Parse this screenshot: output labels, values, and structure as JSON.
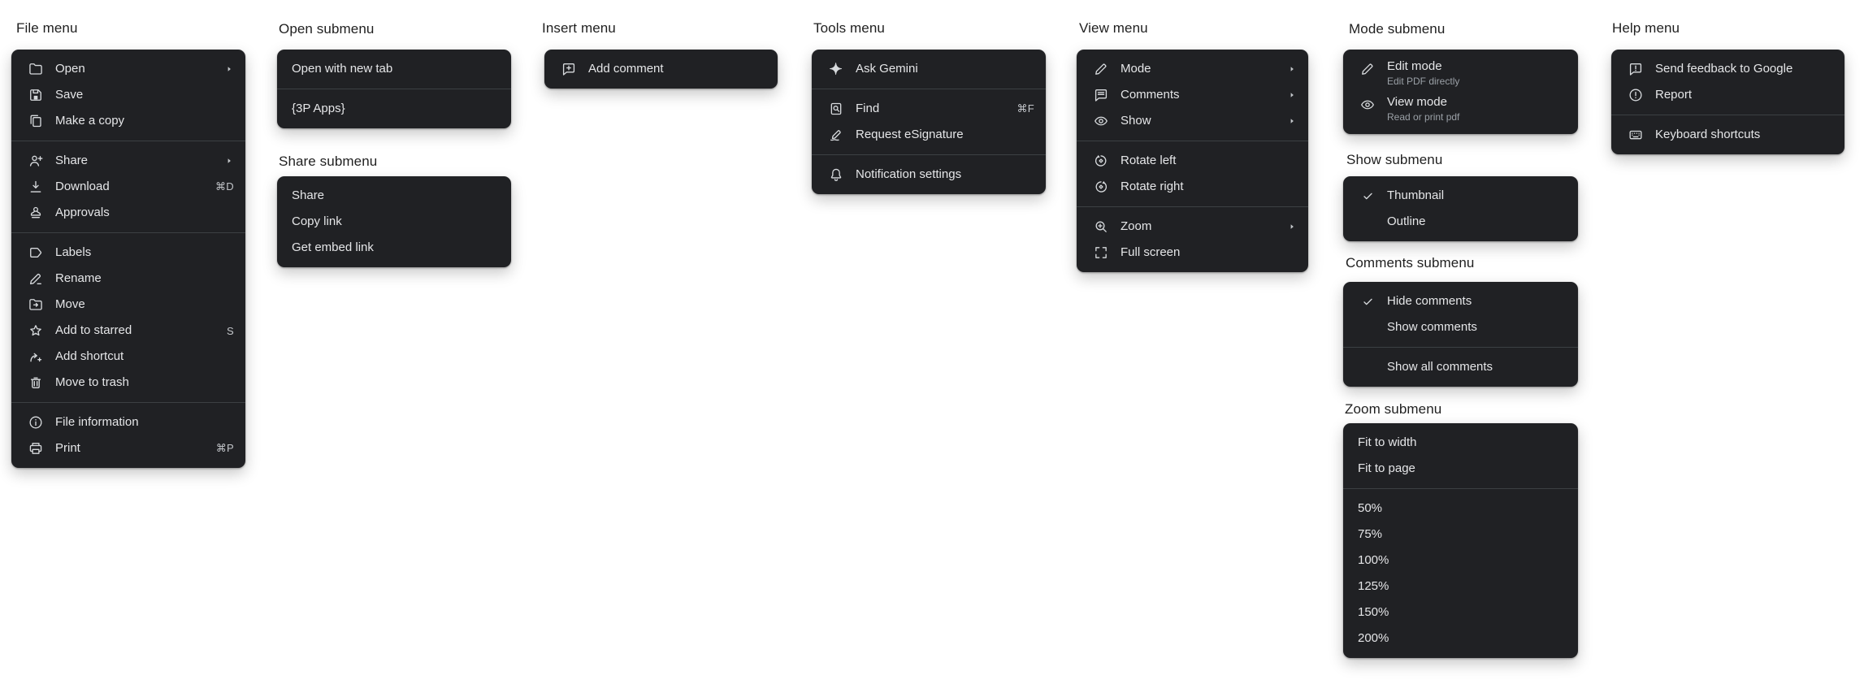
{
  "colors": {
    "page_background": "#ffffff",
    "panel_background": "#202124",
    "panel_text": "#e5e6e8",
    "sublabel_text": "#9aa0a6",
    "shortcut_text": "#c3c6ca",
    "heading_text": "#1f1f1f",
    "divider": "#3c4043",
    "icon": "#d7dadd"
  },
  "menus": {
    "file": {
      "heading": "File menu",
      "items": [
        {
          "label": "Open",
          "icon": "folder-icon",
          "submenu": true
        },
        {
          "label": "Save",
          "icon": "save-icon"
        },
        {
          "label": "Make a copy",
          "icon": "copy-icon"
        },
        {
          "divider": true
        },
        {
          "label": "Share",
          "icon": "person-add-icon",
          "submenu": true
        },
        {
          "label": "Download",
          "icon": "download-icon",
          "shortcut": "⌘D"
        },
        {
          "label": "Approvals",
          "icon": "approvals-stamp-icon"
        },
        {
          "divider": true
        },
        {
          "label": "Labels",
          "icon": "label-icon"
        },
        {
          "label": "Rename",
          "icon": "rename-pencil-icon"
        },
        {
          "label": "Move",
          "icon": "folder-move-icon"
        },
        {
          "label": "Add to starred",
          "icon": "star-icon",
          "shortcut": "S"
        },
        {
          "label": "Add shortcut",
          "icon": "add-shortcut-icon"
        },
        {
          "label": "Move to trash",
          "icon": "trash-icon"
        },
        {
          "divider": true
        },
        {
          "label": "File information",
          "icon": "info-icon"
        },
        {
          "label": "Print",
          "icon": "print-icon",
          "shortcut": "⌘P"
        }
      ]
    },
    "open": {
      "heading": "Open submenu",
      "items": [
        {
          "label": "Open with new tab"
        },
        {
          "divider": true
        },
        {
          "label": "{3P Apps}"
        }
      ]
    },
    "share": {
      "heading": "Share submenu",
      "items": [
        {
          "label": "Share"
        },
        {
          "label": "Copy link"
        },
        {
          "label": "Get embed link"
        }
      ]
    },
    "insert": {
      "heading": "Insert menu",
      "items": [
        {
          "label": "Add comment",
          "icon": "comment-add-icon"
        }
      ]
    },
    "tools": {
      "heading": "Tools menu",
      "items": [
        {
          "label": "Ask Gemini",
          "icon": "spark-icon"
        },
        {
          "divider": true
        },
        {
          "label": "Find",
          "icon": "find-document-icon",
          "shortcut": "⌘F"
        },
        {
          "label": "Request eSignature",
          "icon": "esignature-icon"
        },
        {
          "divider": true
        },
        {
          "label": "Notification settings",
          "icon": "bell-icon"
        }
      ]
    },
    "view": {
      "heading": "View menu",
      "items": [
        {
          "label": "Mode",
          "icon": "pencil-icon",
          "submenu": true
        },
        {
          "label": "Comments",
          "icon": "comment-icon",
          "submenu": true
        },
        {
          "label": "Show",
          "icon": "eye-icon",
          "submenu": true
        },
        {
          "divider": true
        },
        {
          "label": "Rotate left",
          "icon": "rotate-left-icon"
        },
        {
          "label": "Rotate right",
          "icon": "rotate-right-icon"
        },
        {
          "divider": true
        },
        {
          "label": "Zoom",
          "icon": "zoom-in-icon",
          "submenu": true
        },
        {
          "label": "Full screen",
          "icon": "fullscreen-icon"
        }
      ]
    },
    "mode": {
      "heading": "Mode submenu",
      "items": [
        {
          "label": "Edit mode",
          "sublabel": "Edit PDF directly",
          "icon": "pencil-icon"
        },
        {
          "label": "View mode",
          "sublabel": "Read or print pdf",
          "icon": "eye-icon"
        }
      ]
    },
    "show": {
      "heading": "Show submenu",
      "items": [
        {
          "label": "Thumbnail",
          "checked": true
        },
        {
          "label": "Outline"
        }
      ]
    },
    "comments": {
      "heading": "Comments submenu",
      "items": [
        {
          "label": "Hide comments",
          "checked": true
        },
        {
          "label": "Show comments"
        },
        {
          "divider": true
        },
        {
          "label": "Show all comments"
        }
      ]
    },
    "zoom": {
      "heading": "Zoom submenu",
      "items": [
        {
          "label": "Fit to width"
        },
        {
          "label": "Fit to page"
        },
        {
          "divider": true
        },
        {
          "label": "50%"
        },
        {
          "label": "75%"
        },
        {
          "label": "100%"
        },
        {
          "label": "125%"
        },
        {
          "label": "150%"
        },
        {
          "label": "200%"
        }
      ]
    },
    "help": {
      "heading": "Help menu",
      "items": [
        {
          "label": "Send feedback to Google",
          "icon": "feedback-icon"
        },
        {
          "label": "Report",
          "icon": "report-icon"
        },
        {
          "divider": true
        },
        {
          "label": "Keyboard shortcuts",
          "icon": "keyboard-icon"
        }
      ]
    }
  }
}
